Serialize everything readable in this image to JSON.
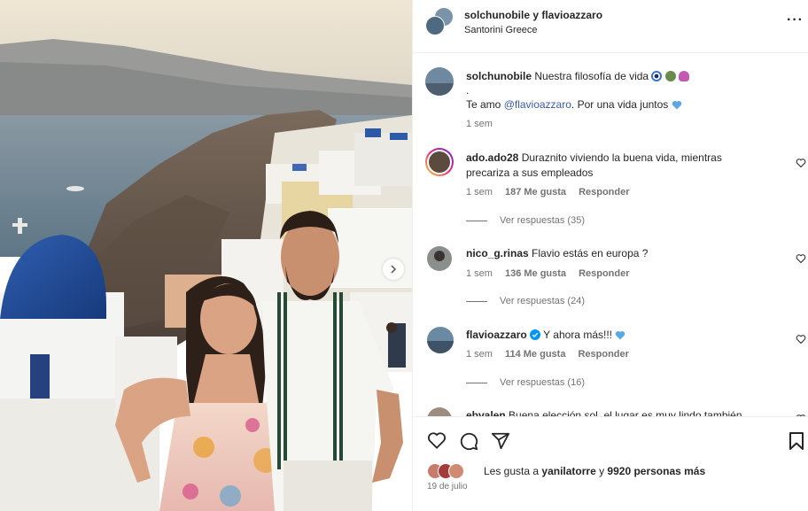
{
  "header": {
    "usernames": "solchunobile y flavioazzaro",
    "location": "Santorini Greece"
  },
  "caption": {
    "user": "solchunobile",
    "text": "Nuestra filosofía de vida",
    "emojis": [
      "nazar-icon",
      "globe-icon",
      "octopus-icon"
    ],
    "dot": ".",
    "line2_prefix": "Te amo ",
    "mention": "@flavioazzaro",
    "line2_suffix": ". Por una vida juntos",
    "time": "1 sem"
  },
  "comments": [
    {
      "user": "ado.ado28",
      "text": "Duraznito viviendo la buena vida, mientras precariza a sus empleados",
      "time": "1 sem",
      "likes": "187 Me gusta",
      "reply": "Responder",
      "view_replies": "Ver respuestas (35)"
    },
    {
      "user": "nico_g.rinas",
      "text": "Flavio estás en europa ?",
      "time": "1 sem",
      "likes": "136 Me gusta",
      "reply": "Responder",
      "view_replies": "Ver respuestas (24)"
    },
    {
      "user": "flavioazzaro",
      "verified": true,
      "text": "Y ahora más!!!",
      "time": "1 sem",
      "likes": "114 Me gusta",
      "reply": "Responder",
      "view_replies": "Ver respuestas (16)"
    },
    {
      "user": "ebvalen",
      "text": "Buena elección sol, el lugar es muy lindo también"
    }
  ],
  "likes": {
    "prefix": "Les gusta a ",
    "user": "yanilatorre",
    "middle": " y ",
    "count": "9920 personas más"
  },
  "date": "19 de julio",
  "colors": {
    "link": "#3b5ba8",
    "verified": "#0095f6",
    "muted": "#737373"
  }
}
